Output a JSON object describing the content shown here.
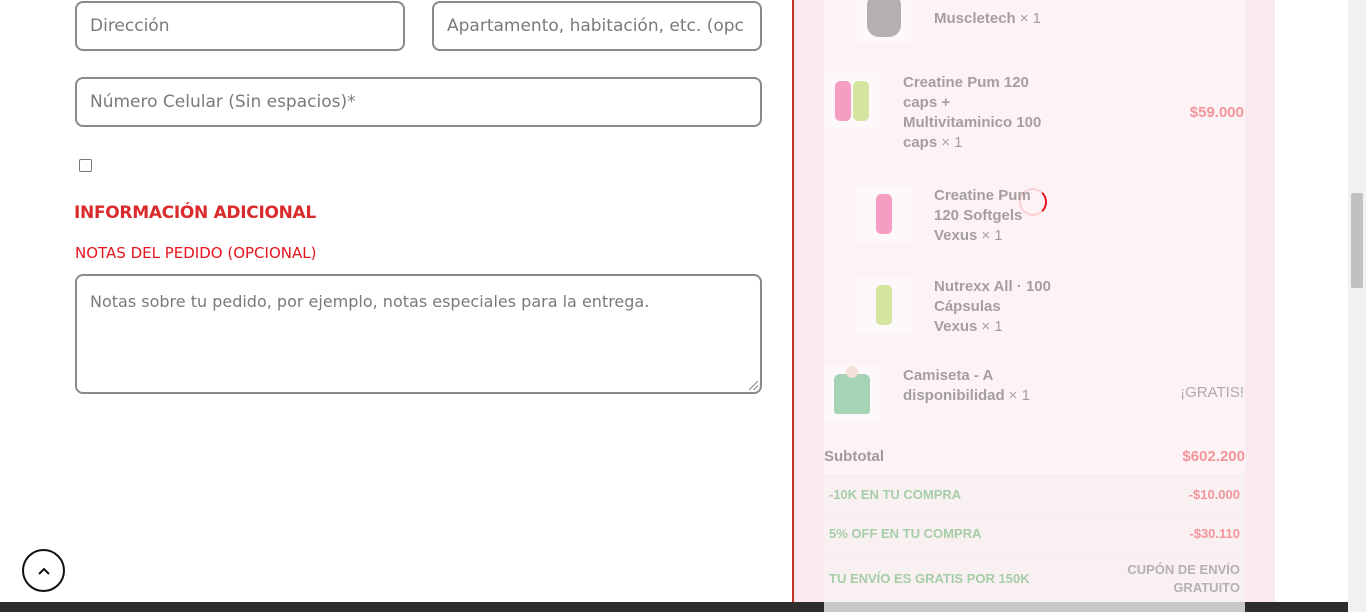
{
  "form": {
    "address_placeholder": "Dirección",
    "apartment_placeholder": "Apartamento, habitación, etc. (opc",
    "phone_placeholder": "Número Celular (Sin espacios)*",
    "section_title": "INFORMACIÓN ADICIONAL",
    "notes_label": "NOTAS DEL PEDIDO (OPCIONAL)",
    "notes_placeholder": "Notas sobre tu pedido, por ejemplo, notas especiales para la entrega."
  },
  "back_to_top_icon": "chevron-up-icon",
  "order": {
    "items": [
      {
        "name": "Embudo Muscletech",
        "name_visible": "Muscletech",
        "qty": "× 1",
        "price": ""
      },
      {
        "name": "Creatine Pum 120 caps + Multivitaminico 100 caps",
        "qty": "× 1",
        "price": "$59.000"
      },
      {
        "name": "Creatine Pum 120 Softgels Vexus",
        "qty": "× 1",
        "price": ""
      },
      {
        "name": "Nutrexx All · 100 Cápsulas Vexus",
        "qty": "× 1",
        "price": ""
      },
      {
        "name": "Camiseta - A disponibilidad",
        "qty": "× 1",
        "price": "¡GRATIS!"
      }
    ],
    "subtotal_label": "Subtotal",
    "subtotal_value": "$602.200",
    "discounts": [
      {
        "label": "-10K EN TU COMPRA",
        "value": "-$10.000"
      },
      {
        "label": "5% OFF EN TU COMPRA",
        "value": "-$30.110"
      },
      {
        "label": "TU ENVÍO ES GRATIS POR 150K",
        "value": "CUPÓN DE ENVÍO GRATUITO"
      }
    ]
  },
  "colors": {
    "accent_red": "#e8141d",
    "discount_green": "#2e9a3a",
    "panel_pink": "#fbe9f2"
  }
}
